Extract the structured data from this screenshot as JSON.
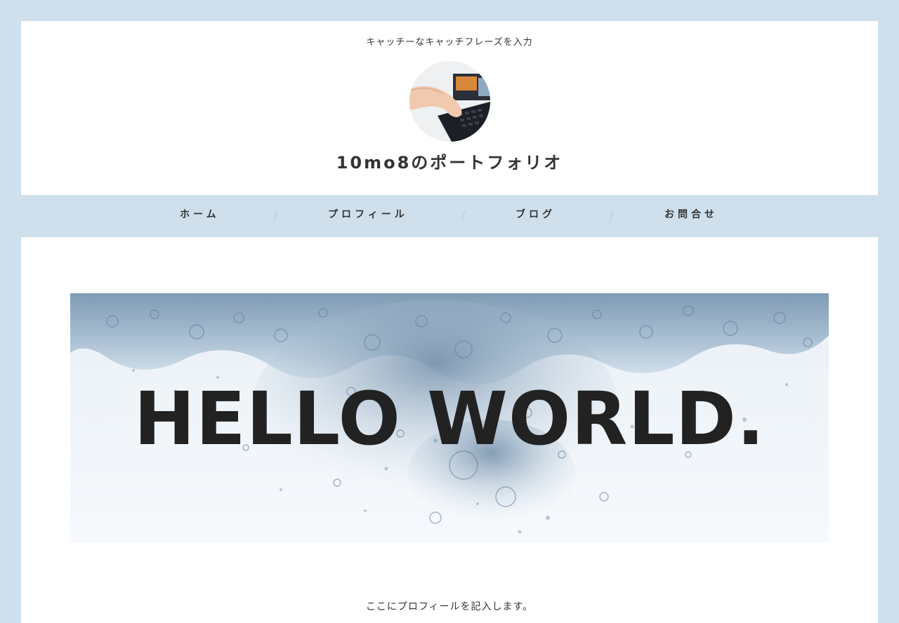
{
  "header": {
    "tagline": "キャッチーなキャッチフレーズを入力",
    "site_title": "10mo8のポートフォリオ",
    "avatar_alt": "hand typing on keyboard"
  },
  "nav": {
    "items": [
      {
        "label": "ホーム"
      },
      {
        "label": "プロフィール"
      },
      {
        "label": "ブログ"
      },
      {
        "label": "お問合せ"
      }
    ]
  },
  "hero": {
    "text": "HELLO WORLD.",
    "image": "water-splash-image"
  },
  "main": {
    "profile_text": "ここにプロフィールを記入します。"
  },
  "colors": {
    "background": "#cfe0ec",
    "nav_background": "#cfe0ec",
    "text": "#333333",
    "hero_text": "#222222"
  }
}
